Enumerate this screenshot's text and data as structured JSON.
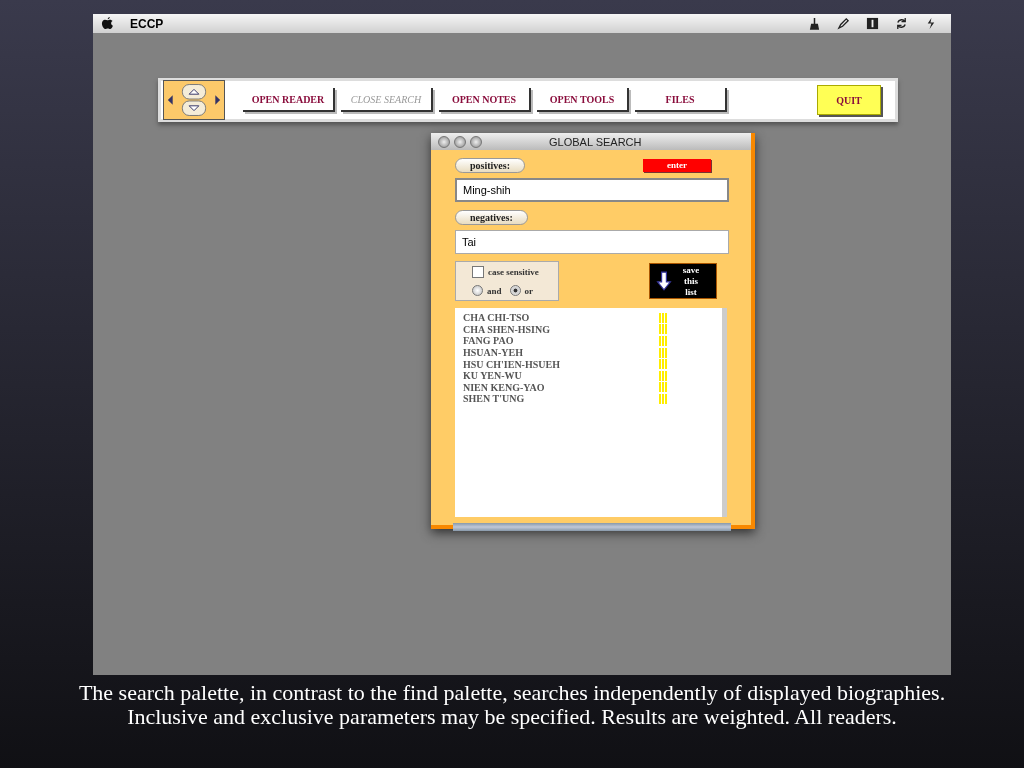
{
  "menu_bar": {
    "app_name": "ECCP"
  },
  "toolbar": {
    "buttons": [
      {
        "label": "OPEN READER",
        "disabled": false
      },
      {
        "label": "CLOSE SEARCH",
        "disabled": true
      },
      {
        "label": "OPEN NOTES",
        "disabled": false
      },
      {
        "label": "OPEN TOOLS",
        "disabled": false
      },
      {
        "label": "FILES",
        "disabled": false
      }
    ],
    "quit": "QUIT"
  },
  "window": {
    "title": "GLOBAL SEARCH",
    "positives": {
      "label": "positives:",
      "value": "Ming-shih"
    },
    "enter": "enter",
    "negatives": {
      "label": "negatives:",
      "value": "Tai"
    },
    "case_sensitive": {
      "label": "case sensitive",
      "checked": false
    },
    "modes": [
      {
        "label": "and",
        "selected": false
      },
      {
        "label": "or",
        "selected": true
      }
    ],
    "save": "save this list",
    "results": [
      {
        "name": "CHA CHI-TSO"
      },
      {
        "name": "CHA SHEN-HSING"
      },
      {
        "name": "FANG PAO"
      },
      {
        "name": "HSUAN-YEH"
      },
      {
        "name": "HSU CH'IEN-HSUEH"
      },
      {
        "name": "KU YEN-WU"
      },
      {
        "name": "NIEN KENG-YAO"
      },
      {
        "name": "SHEN T'UNG"
      }
    ]
  },
  "caption": "The search palette, in contrast to the find palette, searches independently of displayed biographies. Inclusive and exclusive parameters may be specified. Results are weighted. All readers."
}
